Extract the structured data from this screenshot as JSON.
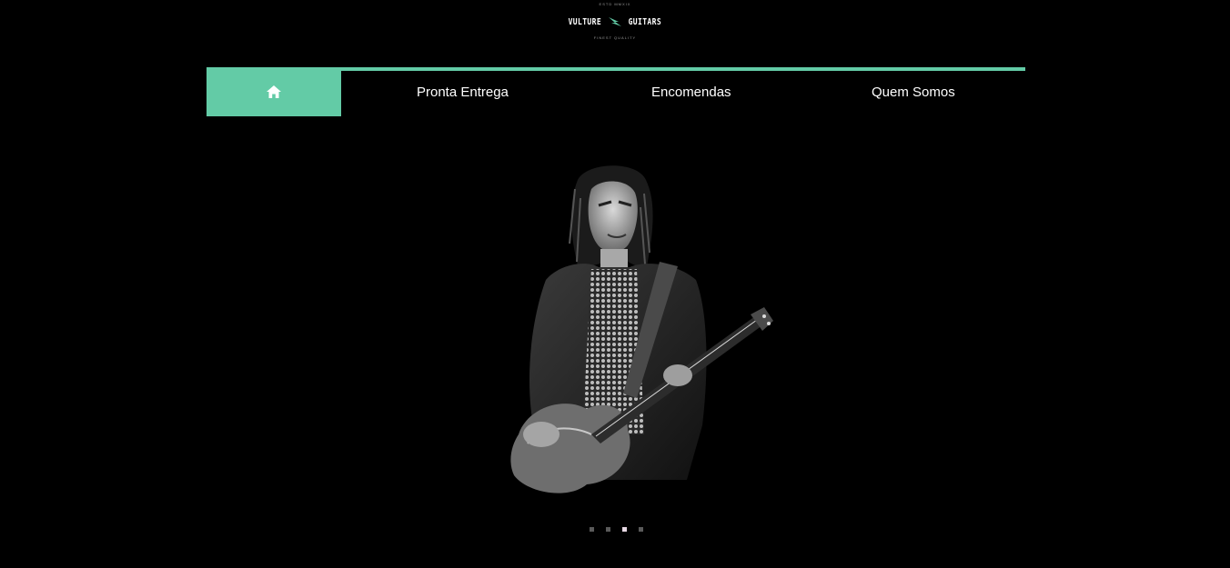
{
  "logo": {
    "top_text": "ESTD MMXIX",
    "word_left": "VULTURE",
    "word_right": "GUITARS",
    "bottom_text": "FINEST QUALITY",
    "accent_color": "#63cba6"
  },
  "nav": {
    "home_icon": "home-icon",
    "items": [
      {
        "label": "Pronta Entrega"
      },
      {
        "label": "Encomendas"
      },
      {
        "label": "Quem Somos"
      }
    ],
    "accent_color": "#63cba6"
  },
  "hero": {
    "image_description_icon": "guitarist-photo",
    "slides_total": 4,
    "active_slide": 3
  }
}
